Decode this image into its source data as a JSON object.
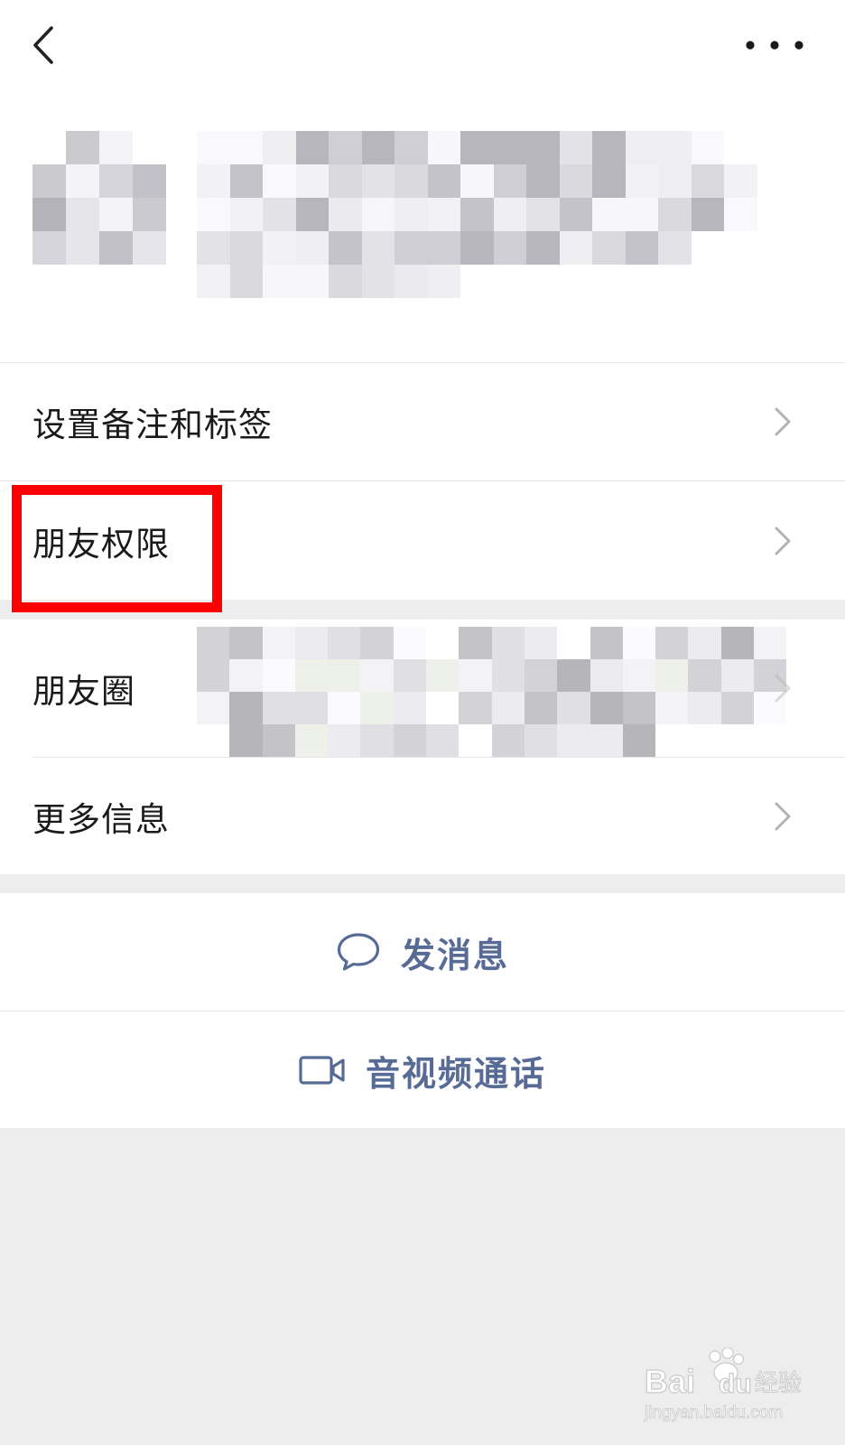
{
  "menu": {
    "remark_tags": "设置备注和标签",
    "friend_permissions": "朋友权限",
    "moments": "朋友圈",
    "more_info": "更多信息"
  },
  "actions": {
    "send_message": "发消息",
    "av_call": "音视频通话"
  },
  "colors": {
    "accent": "#576B95",
    "highlight": "#FF0000",
    "background": "#EDEDED",
    "panel": "#FFFFFF"
  },
  "watermark": {
    "brand": "Bai du 经验",
    "url": "jingyan.baidu.com"
  },
  "icons": {
    "back": "chevron-left-icon",
    "more": "more-dots-icon",
    "row_arrow": "chevron-right-icon",
    "message": "chat-bubble-icon",
    "call": "video-camera-icon"
  }
}
